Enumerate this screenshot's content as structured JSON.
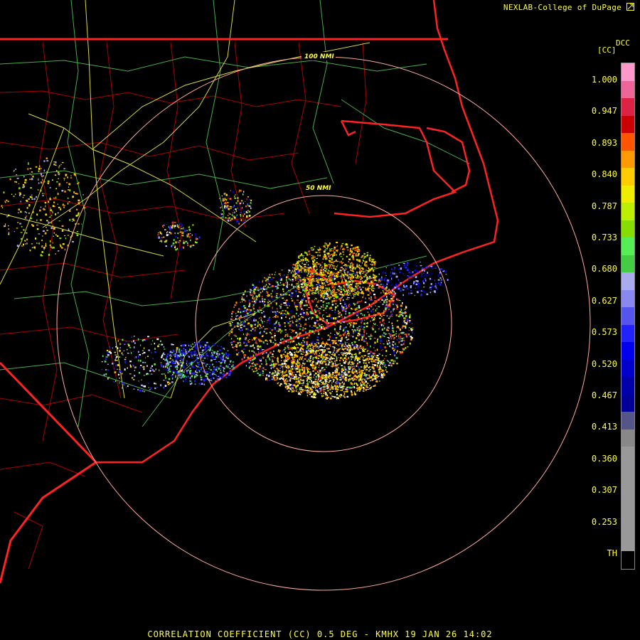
{
  "header": {
    "credit": "NEXLAB-College of DuPage",
    "credit_icon": "arrow-icon"
  },
  "footer": {
    "caption": "CORRELATION COEFFICIENT (CC) 0.5 DEG - KMHX 19 JAN 26 14:02"
  },
  "legend": {
    "unit": "[CC]",
    "code": "DCC",
    "ticks": [
      "1.000",
      "0.947",
      "0.893",
      "0.840",
      "0.787",
      "0.733",
      "0.680",
      "0.627",
      "0.573",
      "0.520",
      "0.467",
      "0.413",
      "0.360",
      "0.307",
      "0.253",
      "TH"
    ],
    "colors": [
      "#ff99cc",
      "#ee6699",
      "#dd2244",
      "#cc0000",
      "#ff5500",
      "#ff9900",
      "#ffcc00",
      "#eeee00",
      "#bbee00",
      "#88dd00",
      "#55ee55",
      "#44cc44",
      "#aaaaee",
      "#8888ee",
      "#5555ee",
      "#2222ff",
      "#0000ee",
      "#0000cc",
      "#0000aa",
      "#000099",
      "#555588",
      "#888888",
      "#999999",
      "#999999",
      "#999999",
      "#999999",
      "#999999",
      "#999999",
      "#000000"
    ]
  },
  "map": {
    "rings": [
      {
        "label": "50 NMI"
      },
      {
        "label": "100 NMI"
      }
    ],
    "colors": {
      "state_border": "#ff2222",
      "county_border": "#aa0000",
      "highway": "#ffff44",
      "road": "#55cc55",
      "ring": "#ffaa99"
    }
  }
}
